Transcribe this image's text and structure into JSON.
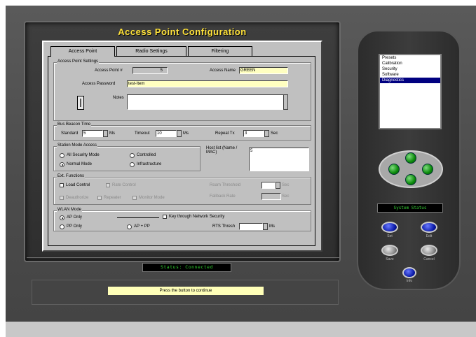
{
  "title": "Access Point Configuration",
  "tabs": [
    {
      "label": "Access Point",
      "active": true
    },
    {
      "label": "Radio Settings",
      "active": false
    },
    {
      "label": "Filtering",
      "active": false
    }
  ],
  "ap_settings": {
    "group_label": "Access Point Settings",
    "ap_number_label": "Access Point #",
    "ap_number_value": "5",
    "access_name_label": "Access Name",
    "access_name_value": "GREEN",
    "password_label": "Access Password",
    "password_value": "test-Item",
    "notes_label": "Notes",
    "notes_value": ""
  },
  "beacon": {
    "group_label": "Bus Beacon Time",
    "standard_label": "Standard",
    "standard_value": "5",
    "standard_unit": "Ms",
    "timeout_label": "Timeout",
    "timeout_value": "10",
    "timeout_unit": "Ms",
    "repeat_label": "Repeat Tx",
    "repeat_value": "3",
    "repeat_unit": "Sec"
  },
  "station_mode": {
    "group_label": "Station Mode Access",
    "options": [
      {
        "label": "All Security Mode",
        "on": false
      },
      {
        "label": "Controlled",
        "on": false
      },
      {
        "label": "Normal Mode",
        "on": true
      },
      {
        "label": "Infrastructure",
        "on": false
      }
    ],
    "host_label": "Host list (Name / MAC)",
    "host_value": "5"
  },
  "functions": {
    "group_label": "Ext. Functions",
    "checks": [
      {
        "label": "Load Control",
        "dim": false
      },
      {
        "label": "Rate Control",
        "dim": true
      },
      {
        "label": "Deauthorize",
        "dim": true
      },
      {
        "label": "Repeater",
        "dim": true
      },
      {
        "label": "Monitor Mode",
        "dim": true
      }
    ],
    "roam_label": "Roam Threshold",
    "roam_unit": "Sec",
    "fallback_label": "Fallback Rate",
    "fallback_unit": "Sec"
  },
  "wlan": {
    "group_label": "WLAN Mode",
    "ap_only": "AP Only",
    "pp_only": "PP Only",
    "ap_pp": "AP + PP",
    "check_label": "Key through Network Security",
    "rts_label": "RTS Thresh",
    "rts_unit": "Ms"
  },
  "lcd_text": "Status: Connected",
  "message": "Press the button to continue",
  "mode_list": [
    "Presets",
    "Calibration",
    "Security",
    "Software",
    "Diagnostics"
  ],
  "mode_selected_index": 4,
  "status_display": "System Status",
  "side_buttons": {
    "set": "Set",
    "edit": "Edit",
    "save": "Save",
    "cancel": "Cancel",
    "info": "Info"
  },
  "colors": {
    "title": "#ffe23a",
    "lcd_green": "#2fd02f",
    "selection": "#000080",
    "message_bg": "#ffffb8"
  }
}
